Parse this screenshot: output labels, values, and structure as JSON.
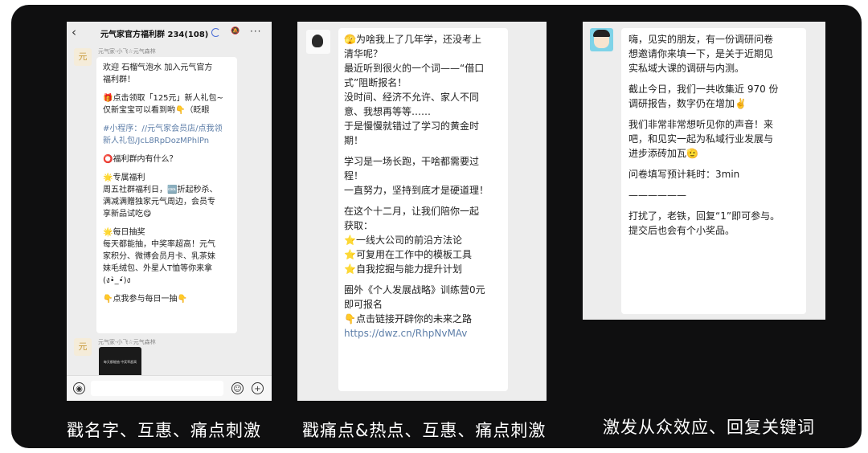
{
  "captions": {
    "c1": "戳名字、互惠、痛点刺激",
    "c2": "戳痛点&热点、互惠、痛点刺激",
    "c3": "激发从众效应、回复关键词"
  },
  "chat1": {
    "back_icon": "‹",
    "title": "元气家官方福利群 234(108)",
    "more_icon": "···",
    "sender1": "元气家-小飞☆元气森林",
    "msg_lines": [
      "欢迎 石榴气泡水 加入元气官方",
      "福利群！",
      "",
      "🎁点击领取「125元」新人礼包~",
      "仅新宝宝可以看到哟👇（眨眼",
      "",
      "#小程序：//元气家会员店/点我领",
      "新人礼包/JcL8RpDozMPhlPn",
      "",
      "⭕福利群内有什么？",
      "",
      "🌟专属福利",
      "周五社群福利日，🆒折起秒杀、",
      "满减满赠独家元气周边，会员专",
      "享新品试吃😋",
      "",
      "🌟每日抽奖",
      "每天都能抽，中奖率超高！元气",
      "家积分、微博会员月卡、乳茶妹",
      "妹毛绒包、外星人T恤等你来拿",
      "(ง•̀_•́)ง",
      "",
      "👇点我参与每日一抽👇"
    ],
    "sender2": "元气家-小飞☆元气森林",
    "card_text": "每天都能抽 中奖率超高",
    "voice_icon": "voice-icon",
    "emoji_icon": "emoji-icon",
    "plus_icon": "plus-icon"
  },
  "chat2": {
    "msg_lines": [
      "🫣为啥我上了几年学，还没考上",
      "清华呢？",
      "最近听到很火的一个词——“借口",
      "式”阻断报名！",
      "没时间、经济不允许、家人不同",
      "意、我想再等等……",
      "于是慢慢就错过了学习的黄金时",
      "期！",
      "",
      "学习是一场长跑，干啥都需要过",
      "程！",
      "一直努力，坚持到底才是硬道理！",
      "",
      "在这个十二月，让我们陪你一起",
      "获取：",
      "⭐一线大公司的前沿方法论",
      "⭐可复用在工作中的模板工具",
      "⭐自我挖掘与能力提升计划",
      "",
      "圈外《个人发展战略》训练营0元",
      "即可报名",
      "👇点击链接开辟你的未来之路",
      "https://dwz.cn/RhpNvMAv"
    ]
  },
  "chat3": {
    "msg_lines": [
      "嗨，见实的朋友，有一份调研问卷",
      "想邀请你来填一下，是关于近期见",
      "实私域大课的调研与内测。",
      "",
      "截止今日，我们一共收集近 970 份",
      "调研报告，数字仍在增加✌️",
      "",
      "我们非常非常想听见你的声音！来",
      "吧，和见实一起为私域行业发展与",
      "进步添砖加瓦🫡",
      "",
      "问卷填写预计耗时：3min",
      "",
      "——————",
      "",
      "打扰了，老铁，回复“1”即可参与。",
      "提交后也会有个小奖品。"
    ]
  }
}
